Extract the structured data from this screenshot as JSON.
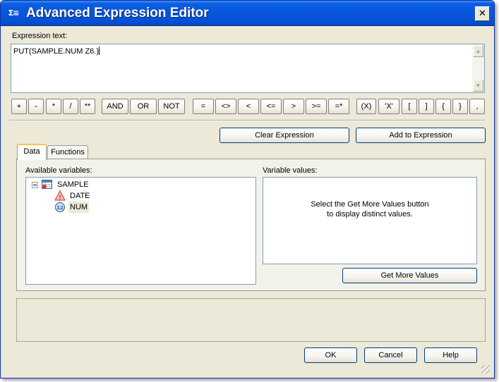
{
  "window": {
    "title": "Advanced Expression Editor",
    "icon_glyph": "Σ≡",
    "close_glyph": "✕"
  },
  "expression": {
    "label": "Expression text:",
    "value": "PUT(SAMPLE.NUM Z6.)"
  },
  "operators": [
    "+",
    "-",
    "*",
    "/",
    "**",
    "AND",
    "OR",
    "NOT",
    "=",
    "<>",
    "<",
    "<=",
    ">",
    ">=",
    "=*",
    "(X)",
    "'X'",
    "[",
    "]",
    "{",
    "}",
    ","
  ],
  "actions": {
    "clear": "Clear Expression",
    "add": "Add to Expression"
  },
  "tabs": [
    {
      "label": "Data",
      "active": true
    },
    {
      "label": "Functions",
      "active": false
    }
  ],
  "data_tab": {
    "available_label": "Available variables:",
    "values_label": "Variable values:",
    "tree": {
      "root": "SAMPLE",
      "children": [
        "DATE",
        "NUM"
      ],
      "selected": "NUM"
    },
    "values_hint_line1": "Select the Get More Values button",
    "values_hint_line2": "to display distinct values.",
    "get_more_values": "Get More Values"
  },
  "footer": {
    "ok": "OK",
    "cancel": "Cancel",
    "help": "Help"
  },
  "colors": {
    "titlebar": "#0855dd",
    "face": "#ece9d8",
    "selection": "#ece9d8"
  }
}
